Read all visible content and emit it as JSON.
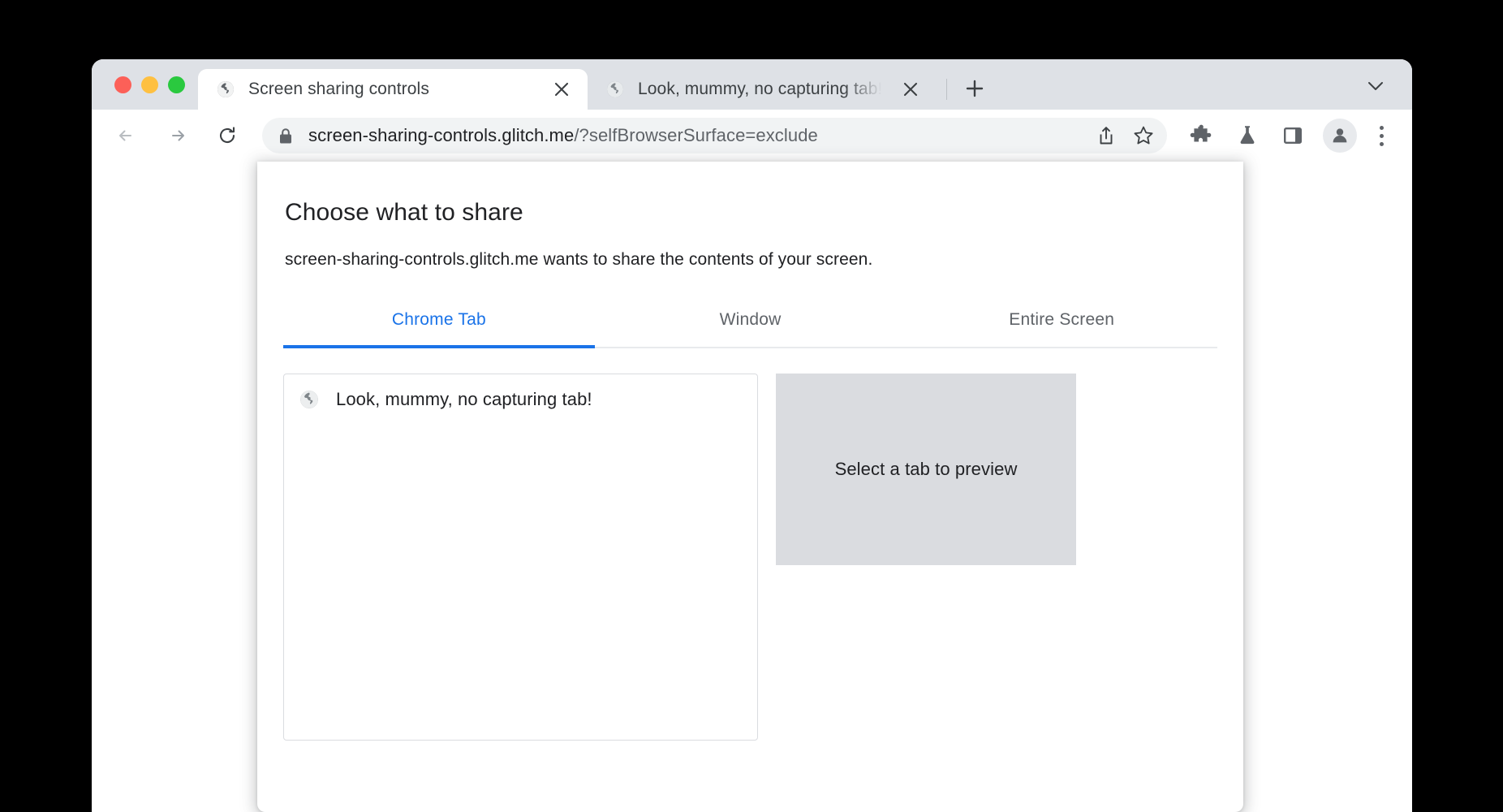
{
  "window": {
    "traffic_lights": [
      "close",
      "minimize",
      "maximize"
    ],
    "colors": {
      "accent_blue": "#1a73e8",
      "tabstrip_bg": "#dee1e6",
      "omnibox_bg": "#f1f3f4",
      "preview_bg": "#dadce0",
      "text_primary": "#202124",
      "text_secondary": "#5f6368",
      "traffic_red": "#fc6058",
      "traffic_yellow": "#fec041",
      "traffic_green": "#2ac93f"
    }
  },
  "tabstrip": {
    "tabs": [
      {
        "title": "Screen sharing controls",
        "favicon": "globe-icon",
        "active": true,
        "close_glyph": "✕"
      },
      {
        "title": "Look, mummy, no capturing tab!",
        "favicon": "globe-icon",
        "active": false,
        "close_glyph": "✕"
      }
    ],
    "new_tab_glyph": "+",
    "tab_search_glyph": "⌄"
  },
  "toolbar": {
    "back_glyph": "←",
    "forward_glyph": "→",
    "reload_glyph": "↻",
    "omnibox": {
      "lock_icon": "lock-icon",
      "url_origin": "screen-sharing-controls.glitch.me",
      "url_path": "/?selfBrowserSurface=exclude",
      "full_url": "screen-sharing-controls.glitch.me/?selfBrowserSurface=exclude",
      "share_icon": "share-icon",
      "bookmark_icon": "star-icon"
    },
    "icons": [
      {
        "name": "extensions-icon",
        "label": "Extensions"
      },
      {
        "name": "labs-icon",
        "label": "Labs"
      },
      {
        "name": "side-panel-icon",
        "label": "Side panel"
      }
    ],
    "avatar_icon": "person-icon",
    "menu_icon": "three-dot-menu-icon"
  },
  "share_dialog": {
    "title": "Choose what to share",
    "subtitle": "screen-sharing-controls.glitch.me wants to share the contents of your screen.",
    "tabs": [
      {
        "label": "Chrome Tab",
        "selected": true
      },
      {
        "label": "Window",
        "selected": false
      },
      {
        "label": "Entire Screen",
        "selected": false
      }
    ],
    "sources": [
      {
        "label": "Look, mummy, no capturing tab!",
        "favicon": "globe-icon"
      }
    ],
    "preview_placeholder": "Select a tab to preview"
  }
}
